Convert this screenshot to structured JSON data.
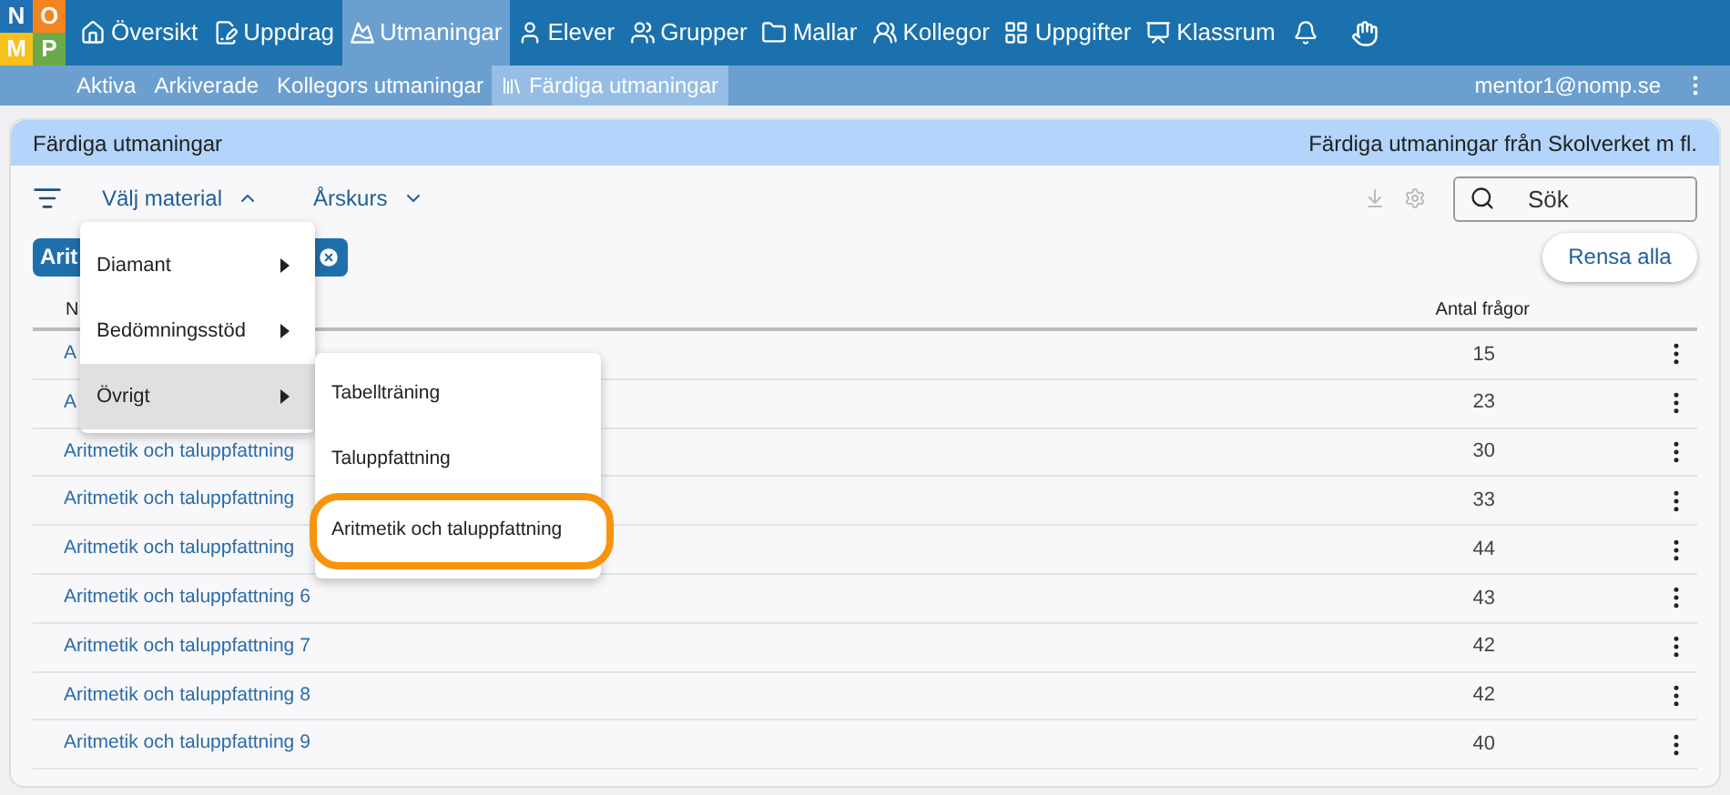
{
  "logo": [
    "N",
    "O",
    "M",
    "P"
  ],
  "nav": [
    {
      "label": "Översikt",
      "selected": false
    },
    {
      "label": "Uppdrag",
      "selected": false
    },
    {
      "label": "Utmaningar",
      "selected": true
    },
    {
      "label": "Elever",
      "selected": false
    },
    {
      "label": "Grupper",
      "selected": false
    },
    {
      "label": "Mallar",
      "selected": false
    },
    {
      "label": "Kollegor",
      "selected": false
    },
    {
      "label": "Uppgifter",
      "selected": false
    },
    {
      "label": "Klassrum",
      "selected": false
    }
  ],
  "subnav": [
    {
      "label": "Aktiva",
      "selected": false
    },
    {
      "label": "Arkiverade",
      "selected": false
    },
    {
      "label": "Kollegors utmaningar",
      "selected": false
    },
    {
      "label": "Färdiga utmaningar",
      "selected": true
    }
  ],
  "user": "mentor1@nomp.se",
  "card": {
    "title": "Färdiga utmaningar",
    "subtitle": "Färdiga utmaningar från Skolverket m fl."
  },
  "filters": [
    {
      "label": "Välj material",
      "expanded": true
    },
    {
      "label": "Årskurs",
      "expanded": false
    }
  ],
  "search": {
    "placeholder": "Sök"
  },
  "chip": "Arit",
  "clear_button": "Rensa alla",
  "table": {
    "columns": [
      "N",
      "Antal frågor"
    ],
    "rows": [
      {
        "name": "A",
        "count": "15"
      },
      {
        "name": "A",
        "count": "23"
      },
      {
        "name": "Aritmetik och taluppfattning",
        "count": "30"
      },
      {
        "name": "Aritmetik och taluppfattning",
        "count": "33"
      },
      {
        "name": "Aritmetik och taluppfattning",
        "count": "44"
      },
      {
        "name": "Aritmetik och taluppfattning 6",
        "count": "43"
      },
      {
        "name": "Aritmetik och taluppfattning 7",
        "count": "42"
      },
      {
        "name": "Aritmetik och taluppfattning 8",
        "count": "42"
      },
      {
        "name": "Aritmetik och taluppfattning 9",
        "count": "40"
      }
    ]
  },
  "menu": [
    {
      "label": "Diamant",
      "selected": false
    },
    {
      "label": "Bedömningsstöd",
      "selected": false
    },
    {
      "label": "Övrigt",
      "selected": true
    }
  ],
  "submenu": [
    {
      "label": "Tabellträning",
      "highlighted": false
    },
    {
      "label": "Taluppfattning",
      "highlighted": false
    },
    {
      "label": "Aritmetik och taluppfattning",
      "highlighted": true
    }
  ]
}
